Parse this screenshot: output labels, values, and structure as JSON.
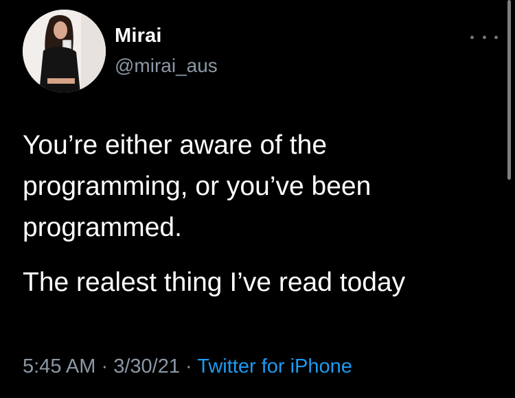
{
  "tweet": {
    "author": {
      "display_name": "Mirai",
      "handle": "@mirai_aus"
    },
    "more_icon": "more-horizontal-icon",
    "text_line_1": "You’re either aware of the programming, or you’ve been programmed.",
    "text_line_2": "The realest thing I’ve read today",
    "time": "5:45 AM",
    "separator": "·",
    "date": "3/30/21",
    "source": "Twitter for iPhone"
  },
  "colors": {
    "background": "#000000",
    "text": "#ffffff",
    "secondary_text": "#8b98a5",
    "link": "#1d9bf0"
  }
}
